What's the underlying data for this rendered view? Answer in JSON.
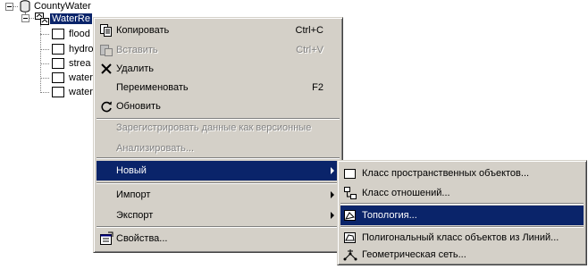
{
  "tree": {
    "root_label": "CountyWater",
    "dataset_label": "WaterRe",
    "children": [
      "flood",
      "hydro",
      "strea",
      "water",
      "water"
    ]
  },
  "context_menu": {
    "items": [
      {
        "label": "Копировать",
        "shortcut": "Ctrl+C",
        "icon": "copy-icon"
      },
      {
        "label": "Вставить",
        "shortcut": "Ctrl+V",
        "icon": "paste-icon",
        "disabled": true
      },
      {
        "label": "Удалить",
        "icon": "delete-icon"
      },
      {
        "label": "Переименовать",
        "shortcut": "F2"
      },
      {
        "label": "Обновить",
        "icon": "refresh-icon"
      },
      {
        "label": "Зарегистрировать данные как версионные",
        "disabled": true
      },
      {
        "label": "Анализировать...",
        "disabled": true
      },
      {
        "label": "Новый",
        "submenu": true,
        "highlighted": true
      },
      {
        "label": "Импорт",
        "submenu": true
      },
      {
        "label": "Экспорт",
        "submenu": true
      },
      {
        "label": "Свойства...",
        "icon": "properties-icon"
      }
    ]
  },
  "submenu": {
    "items": [
      {
        "label": "Класс пространственных объектов...",
        "icon": "feature-class-icon"
      },
      {
        "label": "Класс отношений...",
        "icon": "relationship-class-icon"
      },
      {
        "label": "Топология...",
        "icon": "topology-icon",
        "highlighted": true
      },
      {
        "label": "Полигональный класс объектов из Линий...",
        "icon": "polygon-from-lines-icon"
      },
      {
        "label": "Геометрическая сеть...",
        "icon": "geometric-network-icon"
      }
    ]
  },
  "colors": {
    "highlight": "#0a246a",
    "menu_bg": "#d4d0c8"
  }
}
